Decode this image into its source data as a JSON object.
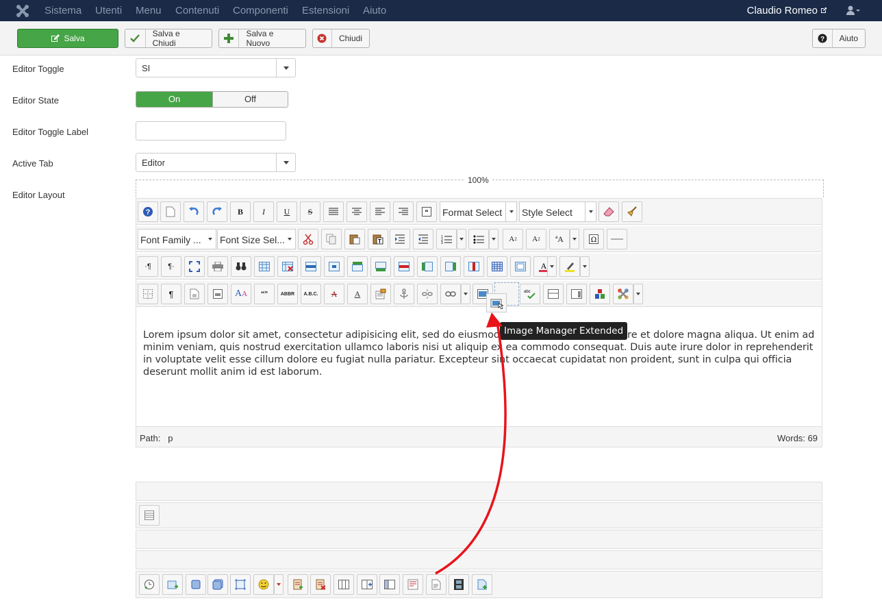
{
  "nav": {
    "items": [
      "Sistema",
      "Utenti",
      "Menu",
      "Contenuti",
      "Componenti",
      "Estensioni",
      "Aiuto"
    ],
    "user": "Claudio Romeo"
  },
  "actions": {
    "save": "Salva",
    "save_close": "Salva e Chiudi",
    "save_new": "Salva e Nuovo",
    "close": "Chiudi",
    "help": "Aiuto"
  },
  "form": {
    "editor_toggle": {
      "label": "Editor Toggle",
      "value": "SI"
    },
    "editor_state": {
      "label": "Editor State",
      "on": "On",
      "off": "Off"
    },
    "editor_toggle_label": {
      "label": "Editor Toggle Label",
      "value": ""
    },
    "active_tab": {
      "label": "Active Tab",
      "value": "Editor"
    },
    "editor_layout": {
      "label": "Editor Layout"
    }
  },
  "editor": {
    "width": "100%",
    "format_select": "Format Select",
    "style_select": "Style Select",
    "font_family": "Font Family ...",
    "font_size": "Font Size Sel...",
    "content": "Lorem ipsum dolor sit amet, consectetur adipisicing elit, sed do eiusmod tempor incididunt ut labore et dolore magna aliqua. Ut enim ad minim veniam, quis nostrud exercitation ullamco laboris nisi ut aliquip ex ea commodo consequat. Duis aute irure dolor in reprehenderit in voluptate velit esse cillum dolore eu fugiat nulla pariatur. Excepteur sint occaecat cupidatat non proident, sunt in culpa qui officia deserunt mollit anim id est laborum.",
    "path_label": "Path:",
    "path_value": "p",
    "words": "Words: 69",
    "tooltip": "Image Manager Extended"
  },
  "colors": {
    "nav_bg": "#1a2a47",
    "save_green": "#46a546",
    "arrow_red": "#e8141a"
  }
}
